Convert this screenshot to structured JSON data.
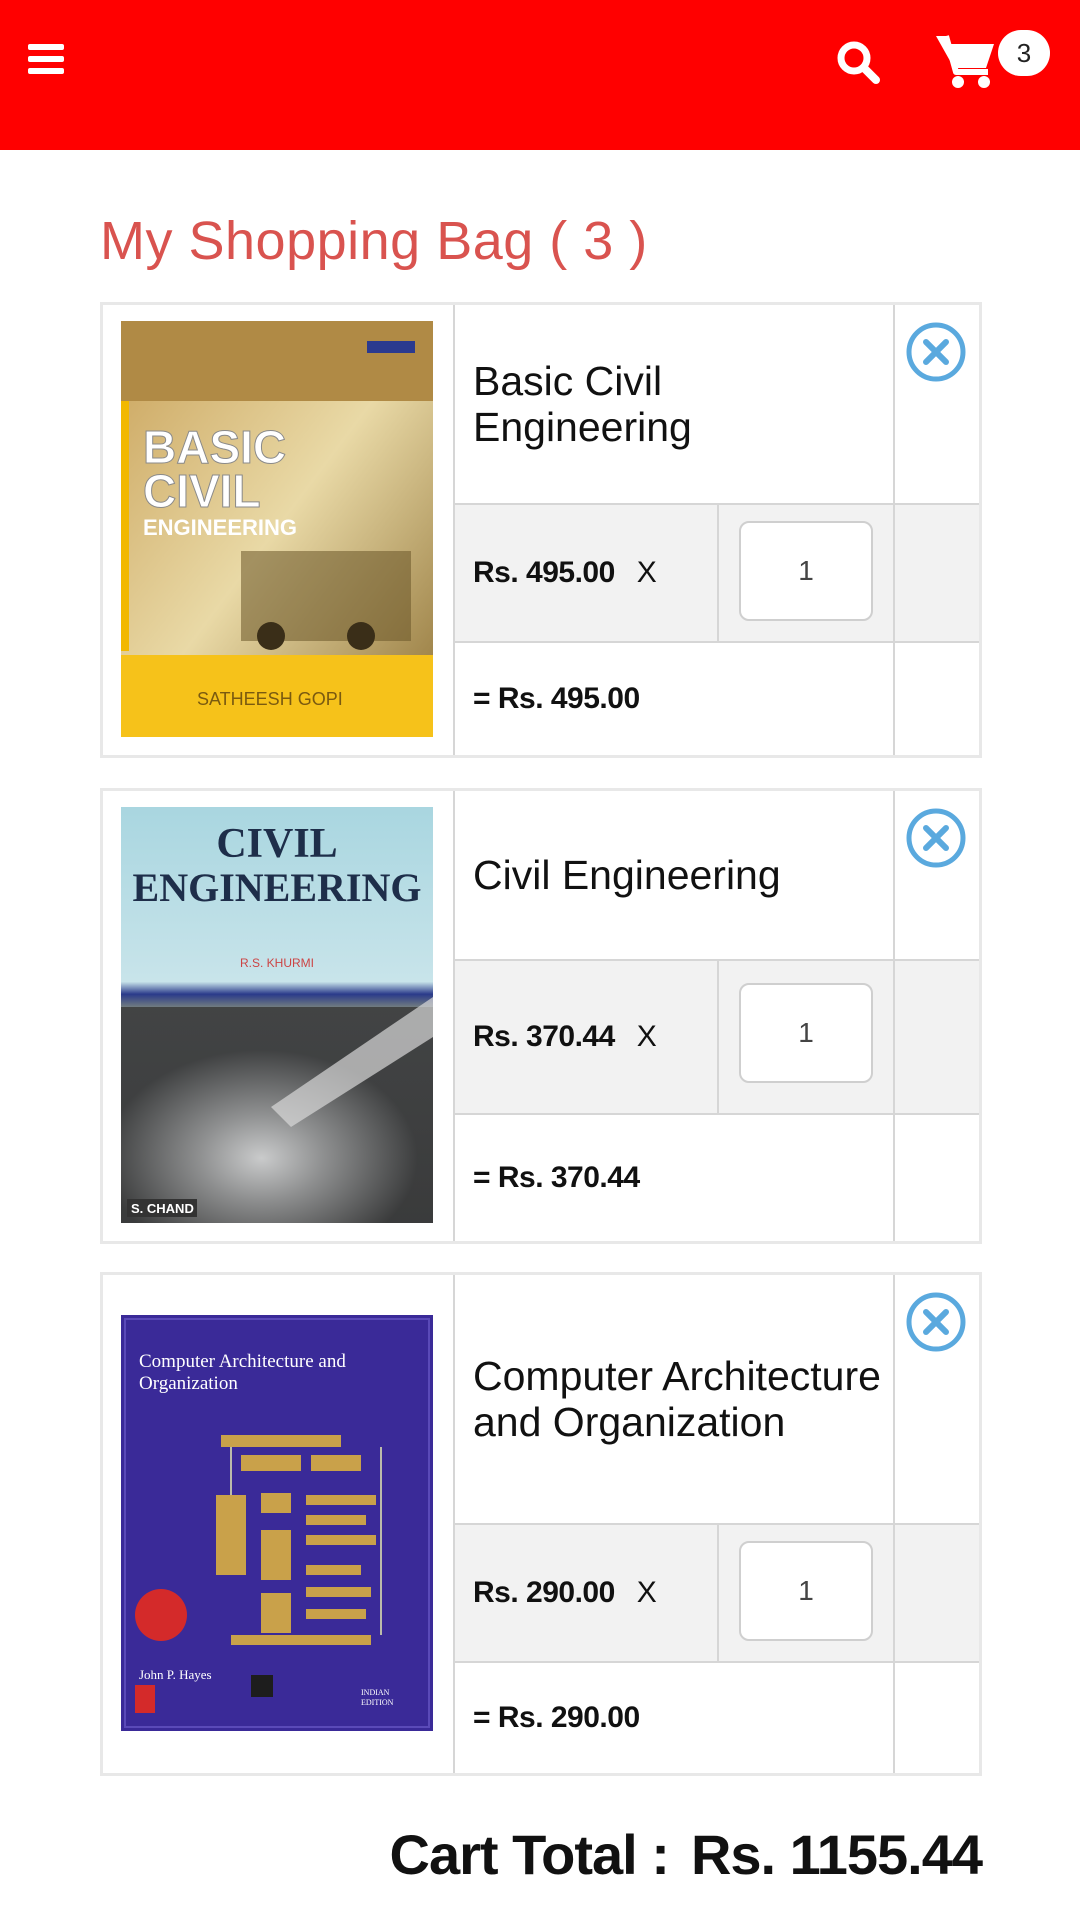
{
  "header": {
    "menu_icon": "hamburger-menu-icon",
    "search_icon": "search-icon",
    "cart_icon": "cart-icon",
    "cart_count": "3",
    "bar_color": "#ff0000"
  },
  "page": {
    "title": "My Shopping Bag ( 3 )",
    "title_color": "#d9534f"
  },
  "items": [
    {
      "name": "Basic Civil Engineering",
      "cover_title": "BASIC CIVIL ENGINEERING",
      "cover_author": "SATHEESH GOPI",
      "unit_price": "Rs. 495.00",
      "times": "X",
      "quantity": "1",
      "subtotal": "= Rs. 495.00"
    },
    {
      "name": "Civil Engineering",
      "cover_title": "CIVIL ENGINEERING",
      "cover_publisher": "S. CHAND",
      "unit_price": "Rs. 370.44",
      "times": "X",
      "quantity": "1",
      "subtotal": "= Rs. 370.44"
    },
    {
      "name": "Computer Architecture and Organization",
      "cover_title": "Computer Architecture and Organization",
      "cover_author": "John P. Hayes",
      "unit_price": "Rs. 290.00",
      "times": "X",
      "quantity": "1",
      "subtotal": "= Rs. 290.00"
    }
  ],
  "summary": {
    "label": "Cart Total :",
    "amount": "Rs. 1155.44"
  }
}
